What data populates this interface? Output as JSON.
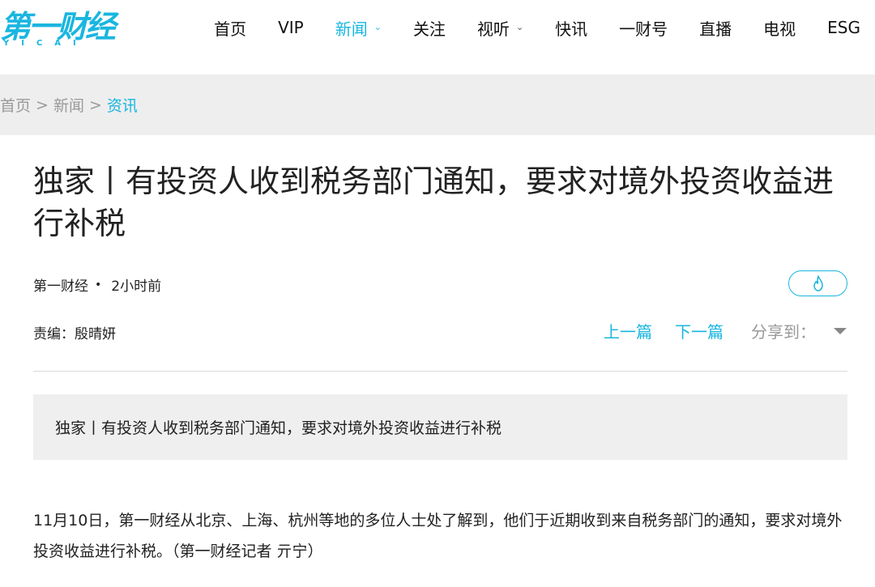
{
  "header": {
    "logo_text": "第一财经",
    "logo_sub": "YICAI",
    "nav": [
      {
        "label": "首页",
        "active": false,
        "dropdown": false
      },
      {
        "label": "VIP",
        "active": false,
        "dropdown": false
      },
      {
        "label": "新闻",
        "active": true,
        "dropdown": true
      },
      {
        "label": "关注",
        "active": false,
        "dropdown": false
      },
      {
        "label": "视听",
        "active": false,
        "dropdown": true
      },
      {
        "label": "快讯",
        "active": false,
        "dropdown": false
      },
      {
        "label": "一财号",
        "active": false,
        "dropdown": false
      },
      {
        "label": "直播",
        "active": false,
        "dropdown": false
      },
      {
        "label": "电视",
        "active": false,
        "dropdown": false
      },
      {
        "label": "ESG",
        "active": false,
        "dropdown": false
      }
    ]
  },
  "breadcrumb": {
    "home": "首页",
    "section": "新闻",
    "current": "资讯",
    "separator": ">"
  },
  "article": {
    "title": "独家丨有投资人收到税务部门通知，要求对境外投资收益进行补税",
    "source": "第一财经",
    "dot": "•",
    "time": "2小时前",
    "editor": "责编：殷晴妍",
    "prev_label": "上一篇",
    "next_label": "下一篇",
    "share_label": "分享到：",
    "summary": "独家丨有投资人收到税务部门通知，要求对境外投资收益进行补税",
    "body": "11月10日，第一财经从北京、上海、杭州等地的多位人士处了解到，他们于近期收到来自税务部门的通知，要求对境外投资收益进行补税。（第一财经记者 亓宁）"
  },
  "colors": {
    "accent": "#19b6e0",
    "breadcrumb_bg": "#eeeeee",
    "summary_bg": "#efefef"
  },
  "icons": {
    "hot": "fire-icon",
    "share_dropdown": "caret-down-icon",
    "nav_dropdown": "chevron-down-icon"
  }
}
